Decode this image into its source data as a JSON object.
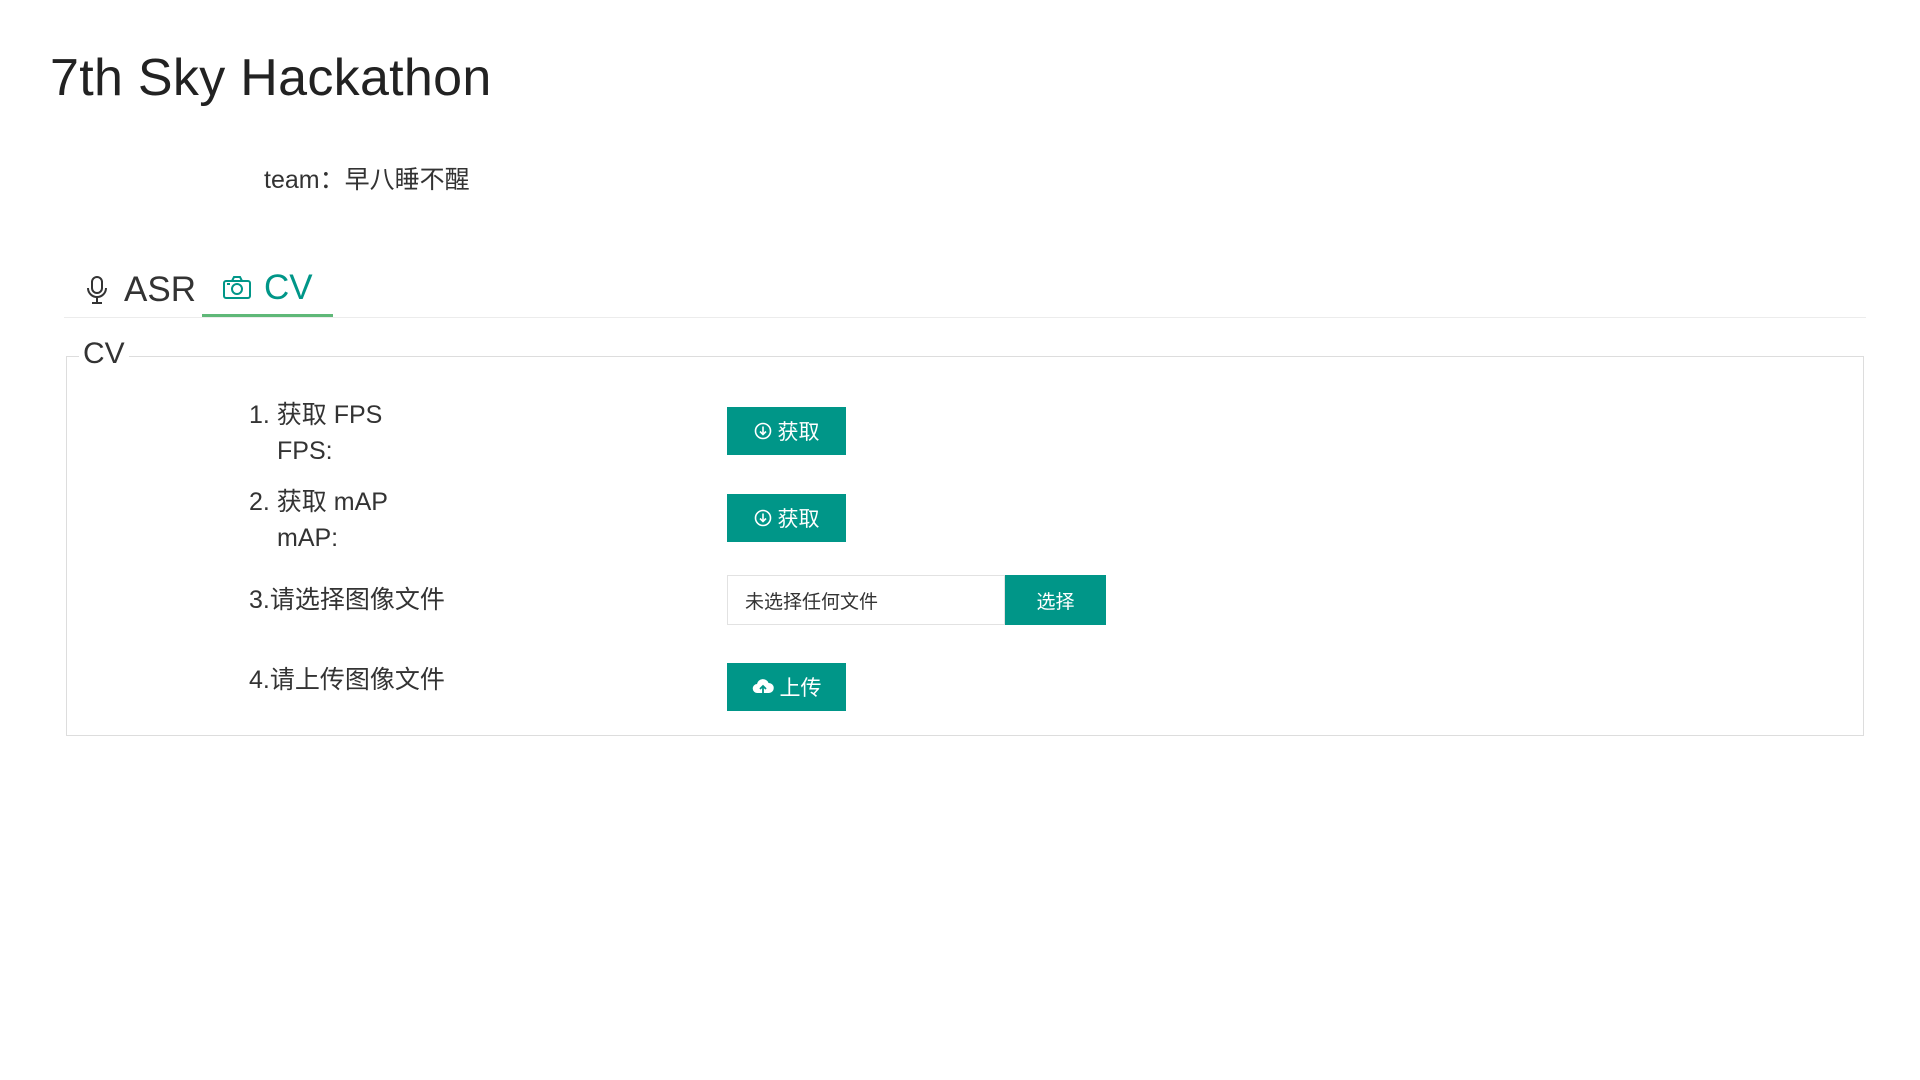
{
  "page": {
    "title": "7th Sky Hackathon",
    "team_line": "team：早八睡不醒"
  },
  "tabs": [
    {
      "label": "ASR",
      "icon": "microphone-icon",
      "active": false
    },
    {
      "label": "CV",
      "icon": "camera-icon",
      "active": true
    }
  ],
  "panel": {
    "legend": "CV",
    "rows": {
      "fps": {
        "label": "1. 获取 FPS",
        "value_label": "FPS:",
        "button": "获取",
        "icon": "download-circle-icon"
      },
      "map": {
        "label": "2. 获取 mAP",
        "value_label": "mAP:",
        "button": "获取",
        "icon": "download-circle-icon"
      },
      "select": {
        "label": "3.请选择图像文件",
        "file_status": "未选择任何文件",
        "button": "选择"
      },
      "upload": {
        "label": "4.请上传图像文件",
        "button": "上传",
        "icon": "cloud-upload-icon"
      }
    }
  },
  "colors": {
    "accent": "#009688",
    "tab_underline": "#5fb878",
    "text": "#333333"
  }
}
